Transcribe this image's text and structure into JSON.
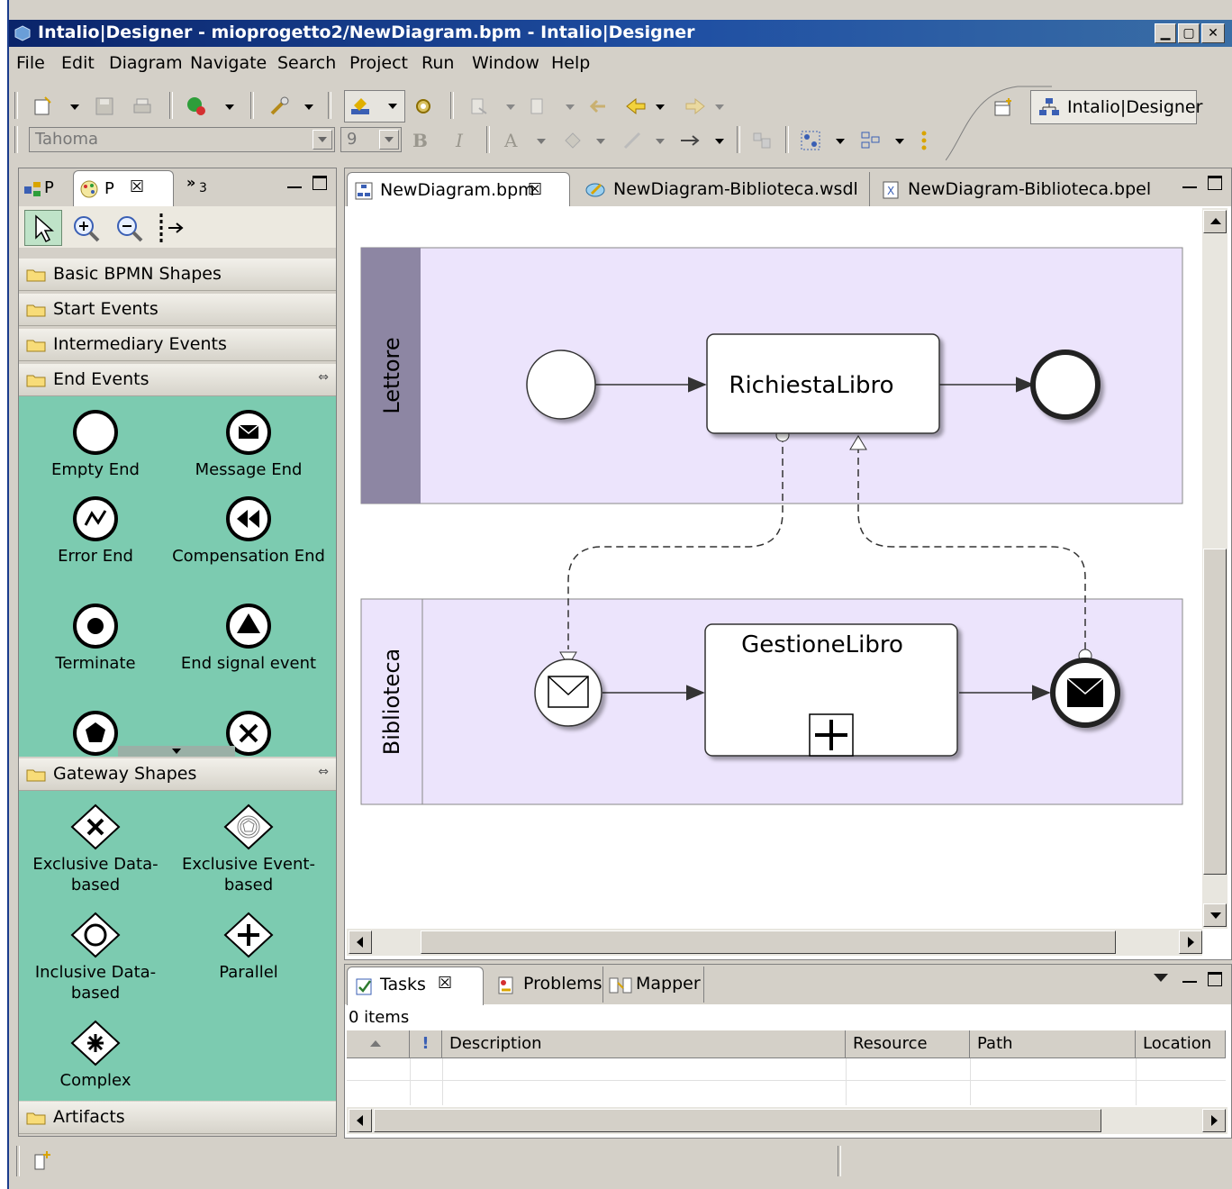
{
  "window": {
    "title": "Intalio|Designer - mioprogetto2/NewDiagram.bpm - Intalio|Designer"
  },
  "menu": [
    "File",
    "Edit",
    "Diagram",
    "Navigate",
    "Search",
    "Project",
    "Run",
    "Window",
    "Help"
  ],
  "toolbar": {
    "font": "Tahoma",
    "size": "9",
    "bold": "B",
    "italic": "I",
    "font_color": "A",
    "perspective": "Intalio|Designer"
  },
  "palette": {
    "tabs": [
      {
        "label": "P"
      },
      {
        "label": "P"
      },
      {
        "label": "3"
      }
    ],
    "drawers": {
      "basic": "Basic BPMN Shapes",
      "start": "Start Events",
      "intermediary": "Intermediary Events",
      "end": "End Events",
      "gateway": "Gateway Shapes",
      "artifacts": "Artifacts"
    },
    "end_events": [
      "Empty End",
      "Message End",
      "Error End",
      "Compensation End",
      "Terminate",
      "End signal event"
    ],
    "gateways": [
      "Exclusive Data-based",
      "Exclusive Event-based",
      "Inclusive Data-based",
      "Parallel",
      "Complex"
    ]
  },
  "editor": {
    "tabs": [
      "NewDiagram.bpm",
      "NewDiagram-Biblioteca.wsdl",
      "NewDiagram-Biblioteca.bpel"
    ],
    "pools": [
      {
        "name": "Lettore"
      },
      {
        "name": "Biblioteca"
      }
    ],
    "tasks": [
      "RichiestaLibro",
      "GestioneLibro"
    ]
  },
  "bottom": {
    "tabs": [
      "Tasks",
      "Problems",
      "Mapper"
    ],
    "count": "0 items",
    "columns": [
      "!",
      "Description",
      "Resource",
      "Path",
      "Location"
    ]
  },
  "colors": {
    "pool": "#ece4fc",
    "pool_header": "#8d86a3",
    "palette_green": "#7ccbb0",
    "title_blue": "#0a246a"
  }
}
